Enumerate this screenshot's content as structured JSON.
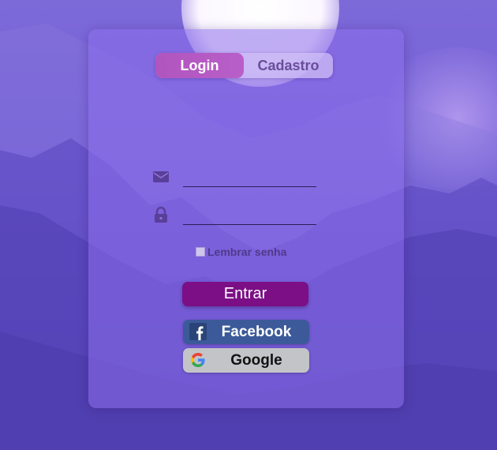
{
  "tabs": {
    "login": "Login",
    "signup": "Cadastro"
  },
  "form": {
    "email_value": "",
    "password_value": "",
    "remember_label": "Lembrar senha",
    "remember_checked": false
  },
  "buttons": {
    "enter": "Entrar",
    "facebook": "Facebook",
    "google": "Google"
  },
  "colors": {
    "accent": "#7c0f86",
    "tab_active": "#b155be",
    "facebook": "#3c5a99",
    "google_bg": "#c3c4c8"
  },
  "icons": {
    "email": "envelope-icon",
    "password": "lock-icon",
    "facebook": "facebook-logo-icon",
    "google": "google-logo-icon"
  }
}
